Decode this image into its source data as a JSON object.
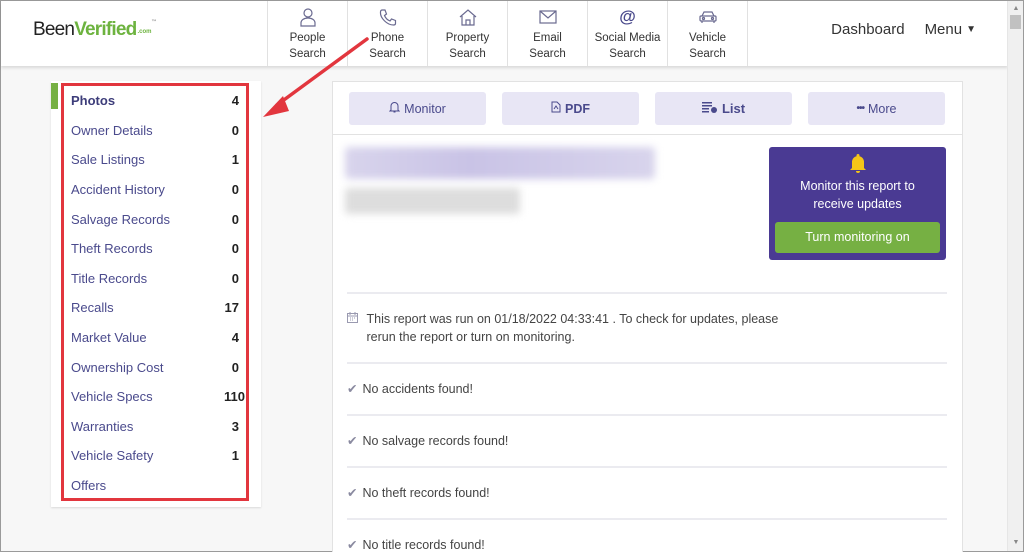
{
  "header": {
    "logo": {
      "part1": "Been",
      "part2": "Verified",
      "suffix": ".com",
      "tm": "™"
    },
    "nav": [
      {
        "icon": "person-icon",
        "line1": "People",
        "line2": "Search"
      },
      {
        "icon": "phone-icon",
        "line1": "Phone",
        "line2": "Search"
      },
      {
        "icon": "house-icon",
        "line1": "Property",
        "line2": "Search"
      },
      {
        "icon": "envelope-icon",
        "line1": "Email",
        "line2": "Search"
      },
      {
        "icon": "at-sign-icon",
        "line1": "Social Media",
        "line2": "Search"
      },
      {
        "icon": "car-icon",
        "line1": "Vehicle",
        "line2": "Search"
      }
    ],
    "dashboard_label": "Dashboard",
    "menu_label": "Menu",
    "menu_caret": "▼"
  },
  "sidebar": {
    "items": [
      {
        "label": "Photos",
        "count": "4",
        "active": true
      },
      {
        "label": "Owner Details",
        "count": "0"
      },
      {
        "label": "Sale Listings",
        "count": "1"
      },
      {
        "label": "Accident History",
        "count": "0"
      },
      {
        "label": "Salvage Records",
        "count": "0"
      },
      {
        "label": "Theft Records",
        "count": "0"
      },
      {
        "label": "Title Records",
        "count": "0"
      },
      {
        "label": "Recalls",
        "count": "17"
      },
      {
        "label": "Market Value",
        "count": "4"
      },
      {
        "label": "Ownership Cost",
        "count": "0"
      },
      {
        "label": "Vehicle Specs",
        "count": "110"
      },
      {
        "label": "Warranties",
        "count": "3"
      },
      {
        "label": "Vehicle Safety",
        "count": "1"
      },
      {
        "label": "Offers",
        "count": ""
      }
    ]
  },
  "toolbar": {
    "monitor_label": "Monitor",
    "pdf_label": "PDF",
    "list_label": "List",
    "more_label": "More"
  },
  "monitor_card": {
    "message": "Monitor this report to receive updates",
    "button_label": "Turn monitoring on"
  },
  "report": {
    "run_text": "This report was run on 01/18/2022 04:33:41 . To check for updates, please rerun the report or turn on monitoring.",
    "findings": [
      "No accidents found!",
      "No salvage records found!",
      "No theft records found!",
      "No title records found!"
    ]
  },
  "colors": {
    "accent_purple": "#4a3a93",
    "accent_green": "#76b043",
    "annotation_red": "#e2363e"
  }
}
